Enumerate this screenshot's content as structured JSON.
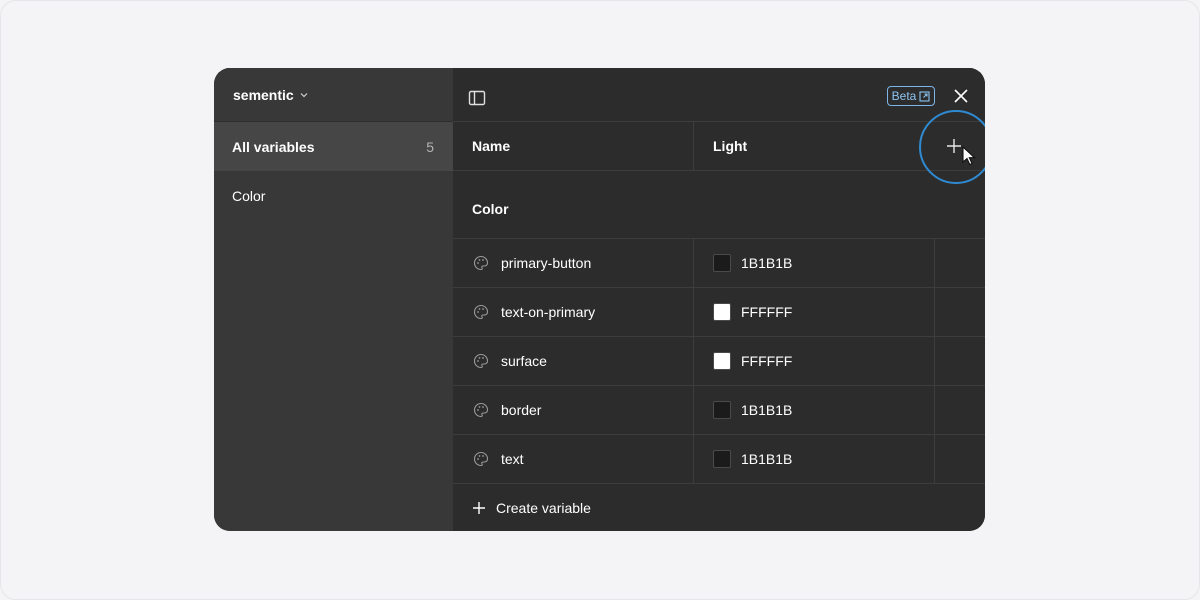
{
  "sidebar": {
    "collection_name": "sementic",
    "items": [
      {
        "label": "All variables",
        "count": "5"
      },
      {
        "label": "Color"
      }
    ]
  },
  "toolbar": {
    "beta_label": "Beta"
  },
  "table": {
    "columns": [
      "Name",
      "Light"
    ],
    "group": "Color",
    "rows": [
      {
        "name": "primary-button",
        "value": "1B1B1B",
        "color": "#1b1b1b"
      },
      {
        "name": "text-on-primary",
        "value": "FFFFFF",
        "color": "#ffffff"
      },
      {
        "name": "surface",
        "value": "FFFFFF",
        "color": "#ffffff"
      },
      {
        "name": "border",
        "value": "1B1B1B",
        "color": "#1b1b1b"
      },
      {
        "name": "text",
        "value": "1B1B1B",
        "color": "#1b1b1b"
      }
    ],
    "create_label": "Create variable"
  },
  "colors": {
    "accent": "#2f8ad1",
    "badge": "#8cc4f0",
    "sidebar_bg": "#383838",
    "panel_bg": "#2c2c2c"
  },
  "icons": [
    "chevron-down-icon",
    "panel-toggle-icon",
    "external-link-icon",
    "close-icon",
    "plus-icon",
    "palette-icon",
    "cursor-arrow-icon"
  ]
}
